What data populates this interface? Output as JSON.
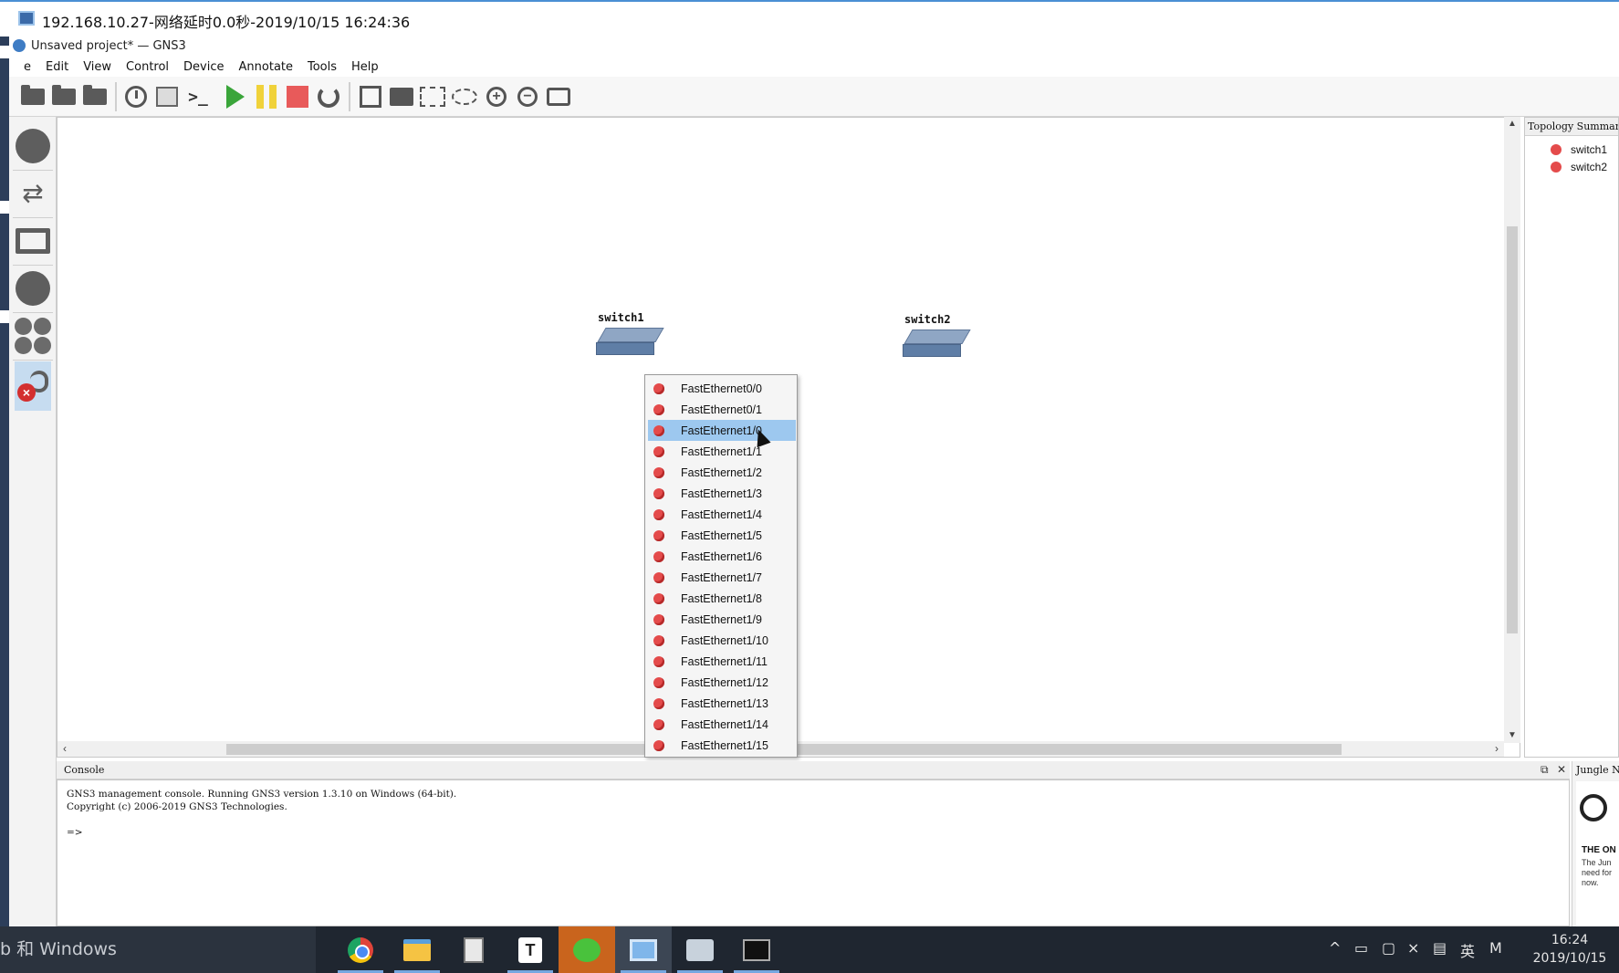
{
  "rdp": {
    "title": "192.168.10.27-网络延时0.0秒-2019/10/15 16:24:36"
  },
  "window": {
    "title": "Unsaved project* — GNS3"
  },
  "menu": [
    "e",
    "Edit",
    "View",
    "Control",
    "Device",
    "Annotate",
    "Tools",
    "Help"
  ],
  "toolbar": {
    "icons": [
      "new-project-icon",
      "open-project-icon",
      "save-project-icon",
      "snapshot-history-icon",
      "snapshot-icon",
      "console-all-icon",
      "start-all-icon",
      "suspend-all-icon",
      "stop-all-icon",
      "reload-all-icon",
      "add-note-icon",
      "insert-image-icon",
      "draw-rectangle-icon",
      "draw-ellipse-icon",
      "zoom-in-icon",
      "zoom-out-icon",
      "screenshot-icon"
    ],
    "colors": {
      "start": "#3aa53a",
      "suspend": "#f0d23a",
      "stop": "#e85a5a"
    }
  },
  "dock": {
    "icons": [
      "routers-icon",
      "switches-icon",
      "end-devices-icon",
      "security-devices-icon",
      "all-devices-icon",
      "add-link-icon"
    ],
    "active": "add-link-icon"
  },
  "canvas": {
    "nodes": [
      {
        "name": "switch1",
        "type": "ethernet-switch"
      },
      {
        "name": "switch2",
        "type": "ethernet-switch"
      }
    ]
  },
  "context_menu": {
    "owner": "switch1",
    "items": [
      "FastEthernet0/0",
      "FastEthernet0/1",
      "FastEthernet1/0",
      "FastEthernet1/1",
      "FastEthernet1/2",
      "FastEthernet1/3",
      "FastEthernet1/4",
      "FastEthernet1/5",
      "FastEthernet1/6",
      "FastEthernet1/7",
      "FastEthernet1/8",
      "FastEthernet1/9",
      "FastEthernet1/10",
      "FastEthernet1/11",
      "FastEthernet1/12",
      "FastEthernet1/13",
      "FastEthernet1/14",
      "FastEthernet1/15"
    ],
    "highlighted_index": 2,
    "status_color": "#e44b4b"
  },
  "topology": {
    "title": "Topology Summary",
    "items": [
      "switch1",
      "switch2"
    ]
  },
  "console": {
    "title": "Console",
    "lines": [
      "GNS3 management console. Running GNS3 version 1.3.10 on Windows (64-bit).",
      "Copyright (c) 2006-2019 GNS3 Technologies.",
      "",
      "=>"
    ]
  },
  "jungle": {
    "title": "Jungle N",
    "heading": "THE ON",
    "text": "The Jun need for now."
  },
  "taskbar": {
    "search_text": "b 和 Windows",
    "apps": [
      "chrome-icon",
      "file-explorer-icon",
      "calculator-icon",
      "typora-icon",
      "wechat-icon",
      "remote-desktop-icon",
      "network-monitor-icon",
      "terminal-icon"
    ],
    "tray": {
      "ime": "英",
      "ime2": "M"
    },
    "time": "16:24",
    "date": "2019/10/15"
  }
}
